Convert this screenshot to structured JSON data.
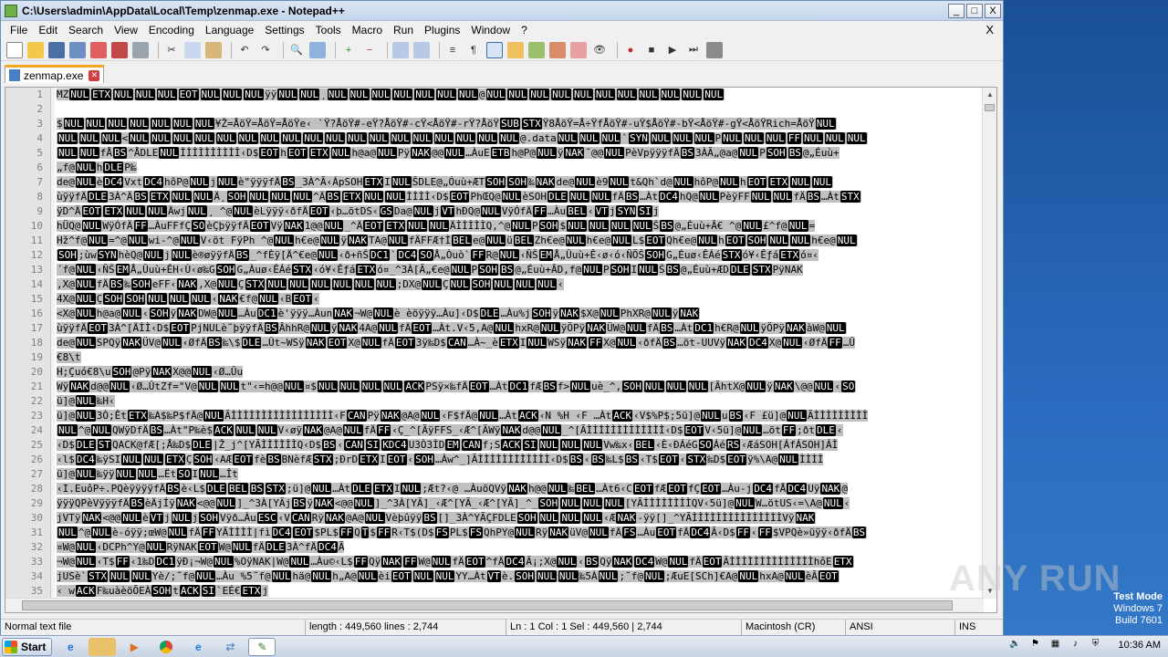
{
  "window": {
    "title": "C:\\Users\\admin\\AppData\\Local\\Temp\\zenmap.exe - Notepad++"
  },
  "caption_buttons": {
    "minimize": "_",
    "maximize": "□",
    "close": "X"
  },
  "menu": [
    "File",
    "Edit",
    "Search",
    "View",
    "Encoding",
    "Language",
    "Settings",
    "Tools",
    "Macro",
    "Run",
    "Plugins",
    "Window",
    "?"
  ],
  "menu_close_doc": "X",
  "toolbar_icons": [
    "new-file-icon",
    "open-file-icon",
    "save-icon",
    "save-all-icon",
    "close-icon",
    "close-all-icon",
    "print-icon",
    "cut-icon",
    "copy-icon",
    "paste-icon",
    "undo-icon",
    "redo-icon",
    "find-icon",
    "replace-icon",
    "zoom-in-icon",
    "zoom-out-icon",
    "sync-v-icon",
    "sync-h-icon",
    "wrap-icon",
    "all-chars-icon",
    "indent-guide-icon",
    "udl-icon",
    "doc-map-icon",
    "function-list-icon",
    "folder-workspace-icon",
    "monitor-icon",
    "record-macro-icon",
    "stop-record-icon",
    "play-macro-icon",
    "play-multiple-icon",
    "save-macro-icon"
  ],
  "tab": {
    "label": "zenmap.exe"
  },
  "editor": {
    "line_numbers": [
      "1",
      "2",
      "3",
      "4",
      "5",
      "6",
      "7",
      "8",
      "9",
      "10",
      "11",
      "12",
      "13",
      "14",
      "15",
      "16",
      "17",
      "18",
      "19",
      "20",
      "21",
      "22",
      "23",
      "24",
      "25",
      "26",
      "27",
      "28",
      "29",
      "30",
      "31",
      "32",
      "33",
      "34",
      "35"
    ],
    "lines": [
      "MZ[NUL][ETX][NUL][NUL][NUL][EOT][NUL][NUL][NUL]ÿÿ[NUL][NUL]¸[NUL][NUL][NUL][NUL][NUL][NUL][NUL]@[NUL][NUL][NUL][NUL][NUL][NUL][NUL][NUL][NUL][NUL][NUL]",
      "",
      "$[NUL][NUL][NUL][NUL][NUL][NUL][NUL]¥Ž=ÅöŸ=ÅöŸ=ÅöŸe‹ `Ÿ?ÅöŸ#-eŸ?ÅöŸ#-cŸ<ÅöŸ#-rŸ?ÅöŸ[SUB][STX]Ÿ8ÅöŸ=Å÷ŸfÅöŸ#-uŸ$ÅöŸ#-bŸ<ÅöŸ#-gŸ<ÅöŸRich=ÅöŸ[NUL]",
      "[NUL][NUL][NUL]<[NUL][NUL][NUL][NUL][NUL][NUL][NUL][NUL][NUL][NUL][NUL][NUL][NUL][NUL][NUL][NUL][NUL][NUL]@.data[NUL][NUL][NUL]`[SYN][NUL][NUL][NUL]P[NUL][NUL][NUL][FF][NUL][NUL][NUL]",
      "[NUL][NUL]fÅ[BS]^ÅDLE[NUL]ÌÌÌÌÌÌÌÌÌÌ‹D$[EOT]h[EOT][ETX][NUL]h@a@[NUL]Pÿ[NAK]@@[NUL]…ÀuE[ETB]h@P@[NUL]ÿ[NAK]˜@@[NUL]PèVpÿÿÿfÄ[BS]3ÀÃ„@a@[NUL]P[SOH][BS]@„Éuù+",
      "„f@[NUL]h[DLE]P‰",
      "de@[NUL]è[DC4]Vxt[DC4]hôP@[NUL]j[NUL]è\"ÿÿÿfÄ[BS]_3À^Ã‹ÁpSOH[ETX]I[NUL]ŠDLE@„Óuù+ÆT[SOH][SOH]‰[NAK]de@[NUL]è9[NUL]t&Qh`d@[NUL]hôP@[NUL]h[EOT][ETX][NUL][NUL]",
      "ùÿÿfÄ[DLE]3À^Ä[BS][ETX][NUL][NUL]Ä¸[SOH][NUL][NUL][NUL]^Ä[BS][ETX][NUL][NUL]ÌÌÌÌ‹D$[EOT]PhŒQ@[NUL]èSOH[DLE][NUL][NUL]fÄ[BS]…Àt[DC4]hQ@[NUL]PèÿFF[NUL][NUL]fÄ[BS]…Àt[STX]",
      "ÿD^Ä[EOT][ETX][NUL][NUL]Äwj[NUL]¸ ^@[NUL]èLÿÿÿ‹ðfÄ[EOT]‹þ…ötDS‹[GS]Da@[NUL]j[VT]hÐQ@[NUL]VÿÓfÄ[FF]…Àu[BEL]‹[VT]j[SYN][SI]j",
      "hÜQ@[NUL]WÿÓfÄ[FF]…ÀuFFfÇ[SO]èÇþÿÿfÄ[EOT]Vÿ[NAK]1@@[NUL]_^Ä[EOT][ETX][NUL][NUL]ÄÌÌÌÌÌQ,^@[NUL]P[SOH]$[NUL][NUL][NUL][NUL]Š[BS]@„Éuù+Â€ ^@[NUL]£^f@[NUL]=",
      "Hž^f@[NUL]=^@[NUL]wi-^@[NUL]V‹öt FÿPh ^@[NUL]h€e@[NUL]ÿ[NAK]TA@[NUL]fÄFFÆ†Ì[BEL]e@[NUL]ü[BEL]Zh€e@[NUL]h€e@[NUL]L$[EOT]Qh€e@[NUL]h[EOT][SOH][NUL][NUL]h€e@[NUL]",
      "[SOH];ùw[SYN]hèQ@[NUL]j[NUL]è®øÿÿfÄ[BS]_^fÈÿ[Ä^€e@[NUL]‹ð+ñŠ[DC1]`[DC4][SO]Å„Òuò`[FF]R@[NUL]‹ÑŠ[EM]Å„Ûuù+Ê‹ø‹ó‹ÑÕŠ[SOH]G„Éuø‹ÊÁé[STX]ó¥‹Êƒá[ETX]ó¤‹",
      "´f@[NUL]‹ÑŠ[EM]Å„Ûuù+ÊH‹Ù‹ø‰G[SOH]G„Àuø‹ÊÁé[STX]‹ó¥‹Êƒá[ETX]ó¤_^3À[Ã„€e@[NUL]P[SOH][BS]@„Éuù+ÂD‚f@[NUL]P[SOH]I[NUL]Š[BS]@„Éuù+ÆD[DLE][STX]PÿNAK",
      "‚X@[NUL]fÄ[BS]‰[SOH]eFF‹[NAK]‚X@[NUL]Ç[STX][NUL][NUL][NUL][NUL][NUL][NUL];DX@[NUL]Ç[NUL][SOH][NUL][NUL][NUL]‹",
      "4X@[NUL]Ç[SOH][SOH][NUL][NUL][NUL]‹[NAK]€f@[NUL]‹B[EOT]‹",
      "<X@[NUL]h@a@[NUL]‹[SOH]ÿ[NAK]DW@[NUL]…Àu[DC1]è'ÿÿÿ…Àun[NAK]¬W@[NUL]è  èöÿÿÿ…Àu]‹D$[DLE]…Àu%j[SOH]ÿ[NAK]$X@[NUL]PhXR@[NUL]ÿ[NAK]",
      "ùÿÿfÄ[EOT]3À^[ÄÌÌ‹D$[EOT]PjNULè˜þÿÿfÄ[BS]ÂhhR@[NUL]ÿ[NAK]4A@[NUL]fÄ[EOT]…Àt.V‹5,A@[NUL]hxR@[NUL]ÿÖPÿ[NAK]ÜW@[NUL]fÄ[BS]…Àt[DC1]h€R@[NUL]ÿÖPÿ[NAK]àW@[NUL]",
      "de@[NUL]SPQÿ[NAK]ÜV@[NUL]‹ØfÄ[BS]‰\\$[DLE]…Ût~WSÿ[NAK][EOT]X@[NUL]fÄ[EOT]3ÿ‰D$[CAN]…À~_è[ETX]I[NUL]WSÿ[NAK][FF]X@[NUL]‹ðfÄ[BS]…öt-UUVÿ[NAK][DC4]X@[NUL]‹ØfÄ[FF]…Û",
      "€8\\t",
      "H;Çuó€8\\u[SOH]@Pÿ[NAK]X@@[NUL]‹Ø…Ûu",
      "Wÿ[NAK]d@@[NUL]‹Ø…ÛtZf=\"V@[NUL][NUL]t\"‹=h@@[NUL]¤$[NUL][NUL][NUL][NUL][ACK]PSÿ×‰fÄ[EOT]…Àt[DC1]fÆ[BS]f>[NUL]uè_^‚[SOH][NUL][NUL][NUL][ÃhtX@[NUL]ÿ[NAK]\\@@[NUL]‹[SO]",
      "ü]@[NUL]‰H‹",
      "ü]@[NUL]3Ò;Êt[ETX]‰A$‰P$fÄ@[NUL]ÃÌÌÌÌÌÌÌÌÌÌÌÌÌÌÌÌÌ‹F[CAN]Pÿ[NAK]@A@[NUL]‹F$fÄ@[NUL]…Àt[ACK]‹N %H ‹F …Àt[ACK]‹V$%P$;5ü]@[NUL]u[BS]‹F £ü]@[NUL]ÃÌÌÌÌÌÌÌÌÌ",
      "[NUL]^@[NUL]QWÿDfÄ[BS]…Àt\"P‰è$[ACK][NUL][NUL]V‹øÿ[NAK]@A@[NUL]fÄ[FF]‹Ç_^[ÃÿFFS_‹Æ^[ÃWÿ[NAK]d@@[NUL]_^[ÃÌÌÌÌÌÌÌÌÌÌÌÌÌ‹D$[EOT]V‹5ü]@[NUL]…öt[FF];ðt[DLE]‹",
      "‹D$[DLE][ST]QACK@fÆ[;Å‰D$[DLE]|Ž_j^[YÃÌÌÌÌÌÌQ‹D$[BS]‹[CAN][SI][KDC4]U3Ò3ÌD[EM][CAN]f;S[ACK][SI][NUL][NUL][NUL]Vw‰x‹[BEL]‹È‹ÐÁéG[SO]Áé[RS]‹ÆáSOH[ÁfÁSOH]ÁÌ",
      "‹l$[DC4]‰ÿSI[NUL][NUL][ETX]Ç[SOH]‹AÆ[EOT]fè[BS]BNèfÆ[STX];ÐrD[ETX]I[EOT]‹[SOH]…Àw^_]ÃÌÌÌÌÌÌÌÌÌÌÌÌ‹D$[BS]‹[BS]‰L$[BS]‹T$[EOT]‹[STX]‰D$[EOT]ÿ%\\A@[NUL]ÌÌÌÌ",
      "ü]@[NUL]‰ÿÿ[NUL][NUL]…Ët[SO]I[NUL]…Ît",
      "‹I.EuôP÷.PQèÿÿÿÿfÄ[BS]è‹L$[DLE][BEL][BS][STX];ü]@[NUL]…Àt[DLE][ETX]I[NUL];Æt?‹@ …ÀuõQVÿ[NAK]h@@[NUL]‰[BEL]…Àt6‹C[EOT]fÆ[EOT]fÇ[EOT]…Àu-j[DC4]fÅ[DC4]Uÿ[NAK]@",
      "ÿÿÿQPèVÿÿÿfÄ[BS]èÄjÍÿ[NAK]<@@[NUL]]_^3À[YÃj[BS]ÿ[NAK]<@@[NUL]]_^3À[YÃ]_‹Æ^[YÃ_‹Æ^[YÃ]_^_[SOH][NUL][NUL][NUL][YÃÌÌÌÌÌÌÌÌQV‹5ü]@[NUL]W…ötUS‹=\\A@[NUL]‹",
      "jVTÿ[NAK]<@@[NUL]è[VT]j[NUL]j[SOH]Vÿð…Àu[ESC]‹V[CAN]Rÿ[NAK]@A@[NUL]Vèþûÿÿ[BS][]_3À^YÃÇFDLE[SOH][NUL][NUL][NUL]‹Æ[NAK]-ÿÿ[]_^YÃÌÌÌÌÌÌÌÌÌÌÌÌÌÌÌVÿ[NAK]",
      "[NUL]^@[NUL]è-óÿÿ;œW@[NUL]fÄ[FF]YÃÌÌÌÌ|fì[DC4][EOT]$PL$[FF]Q[T]$[FF]R‹T$(D$[FS]PL$[FS]QhPY@[NUL]Rÿ[NAK]üV@[NUL]fÄ[FS]…Àu[EOT]fÄ[DC4]Ã‹D$[FF]‹[FF]$VPQè»üÿÿ‹ðfÄ[BS]",
      "¤W@[NUL]‹DCPh^Y@[NUL]RÿNAK[EOT]W@[NUL]fÄ[DLE]3À^fÄ[DC4]Ã",
      "¬W@[NUL]‹T$[FF]‹1‰D[DC1]ÿÐ¡¬W@[NUL]%OÿNAK|W@[NUL]…Àu©‹L$[FF]Qÿ[NAK][FF]W@[NUL]fÄ[EOT]^fÄ[DC4]Ã¡;X@[NUL]‹[BS]Qÿ[NAK][DC4]W@[NUL]fÄ[EOT]ÃÌÌÌÌÌÌÌÌÌÌÌÌÌÌhôE[ETX]",
      "jUSè`[STX][NUL][NUL]Yè/;˜f@[NUL]…Àu %5˜f@[NUL]hä@[NUL]h„A@[NUL]èi[EOT][NUL][NUL]YY…Àt[VT]è.[SOH][NUL][NUL]‰5À[NUL];˜f@[NUL];ÆuE[SCh]€A@[NUL]hxA@[NUL]èÃ[EOT]",
      "‹ w[ACK]F‰uàèöÕEÀ[SOH]t[ACK][SI]`EÉ€[ETX]j"
    ]
  },
  "status": {
    "type": "Normal text file",
    "length": "length : 449,560    lines : 2,744",
    "position": "Ln : 1    Col : 1    Sel : 449,560 | 2,744",
    "eol": "Macintosh (CR)",
    "encoding": "ANSI",
    "mode": "INS"
  },
  "taskbar": {
    "start_label": "Start",
    "apps": [
      "ie-icon",
      "explorer-icon",
      "media-player-icon",
      "chrome-icon",
      "edge-icon",
      "network-icon",
      "notepadpp-icon"
    ],
    "clock": "10:36 AM"
  },
  "os_info": {
    "line1": "Test Mode",
    "line2": "Windows 7",
    "line3": "Build 7601"
  },
  "watermark": "ANY RUN"
}
